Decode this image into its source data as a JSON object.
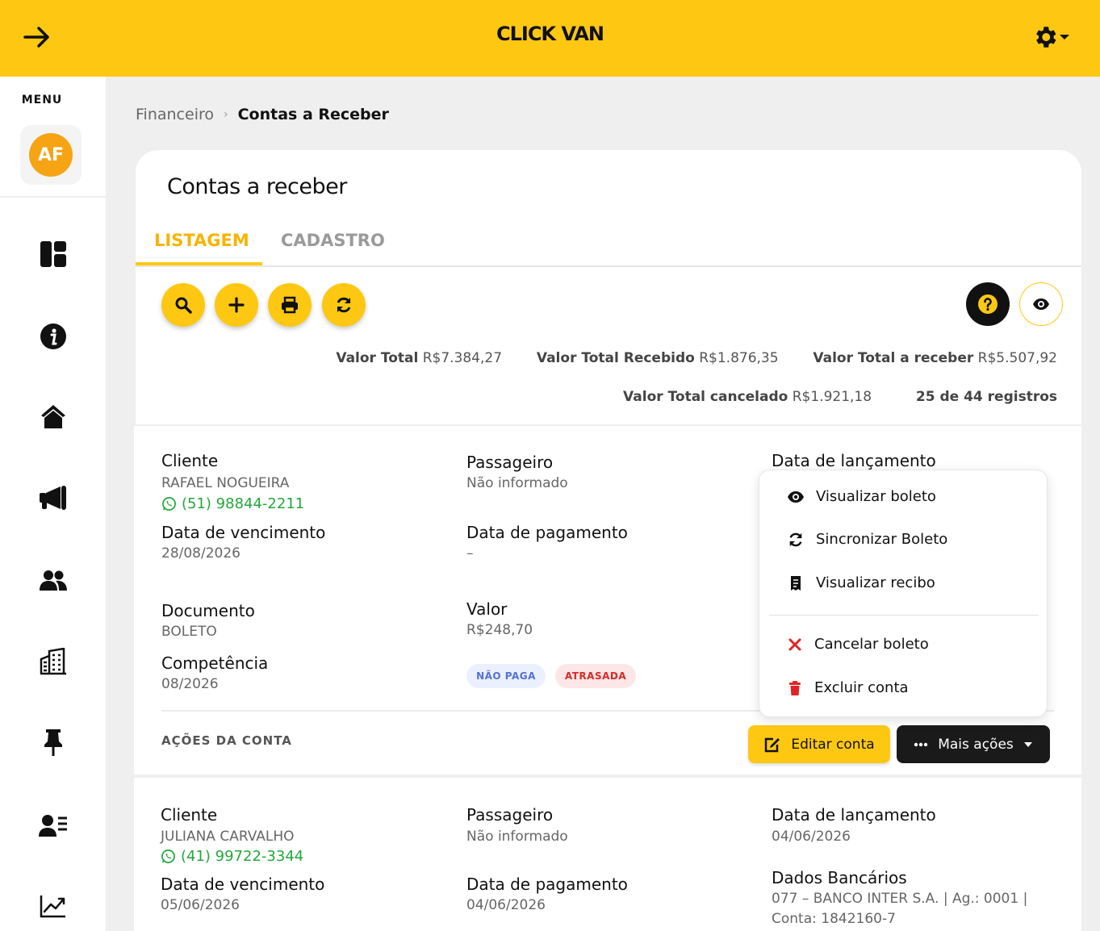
{
  "header": {
    "title": "CLICK VAN",
    "back_icon": "arrow-right-icon",
    "settings_icon": "gear-icon"
  },
  "sidebar": {
    "menu_label": "MENU",
    "avatar_initials": "AF",
    "icons": [
      "dashboard-icon",
      "info-icon",
      "home-icon",
      "megaphone-icon",
      "users-icon",
      "building-icon",
      "pin-icon",
      "contacts-list-icon",
      "chart-line-icon"
    ]
  },
  "breadcrumb": {
    "parent": "Financeiro",
    "separator": "›",
    "current": "Contas a Receber"
  },
  "page": {
    "title": "Contas a receber",
    "tabs": [
      {
        "label": "LISTAGEM",
        "active": true
      },
      {
        "label": "CADASTRO",
        "active": false
      }
    ]
  },
  "toolbar": {
    "buttons": [
      "search-icon",
      "plus-icon",
      "print-icon",
      "refresh-icon"
    ],
    "help_icon": "question-icon",
    "visibility_icon": "eye-icon"
  },
  "totals": {
    "valor_total_label": "Valor Total",
    "valor_total": "R$7.384,27",
    "recebido_label": "Valor Total Recebido",
    "recebido": "R$1.876,35",
    "a_receber_label": "Valor Total a receber",
    "a_receber": "R$5.507,92",
    "cancelado_label": "Valor Total cancelado",
    "cancelado": "R$1.921,18",
    "registros": "25 de 44 registros"
  },
  "labels": {
    "cliente": "Cliente",
    "passageiro": "Passageiro",
    "data_lancamento": "Data de lançamento",
    "data_vencimento": "Data de vencimento",
    "data_pagamento": "Data de pagamento",
    "documento": "Documento",
    "valor": "Valor",
    "competencia": "Competência",
    "dados_bancarios": "Dados Bancários",
    "acoes_da_conta": "AÇÕES DA CONTA",
    "editar_conta": "Editar conta",
    "mais_acoes": "Mais ações"
  },
  "accounts": [
    {
      "cliente": "RAFAEL NOGUEIRA",
      "telefone": "(51) 98844-2211",
      "passageiro": "Não informado",
      "data_vencimento": "28/08/2026",
      "data_pagamento": "–",
      "documento": "BOLETO",
      "valor": "R$248,70",
      "competencia": "08/2026",
      "badges": [
        "NÃO PAGA",
        "ATRASADA"
      ]
    },
    {
      "cliente": "JULIANA CARVALHO",
      "telefone": "(41) 99722-3344",
      "passageiro": "Não informado",
      "data_lancamento": "04/06/2026",
      "data_vencimento": "05/06/2026",
      "data_pagamento": "04/06/2026",
      "dados_bancarios_1": "077 – BANCO INTER S.A. | Ag.: 0001 |",
      "dados_bancarios_2": "Conta: 1842160-7"
    }
  ],
  "dropdown": {
    "items": [
      {
        "label": "Visualizar boleto",
        "icon": "eye-icon"
      },
      {
        "label": "Sincronizar Boleto",
        "icon": "sync-icon"
      },
      {
        "label": "Visualizar recibo",
        "icon": "receipt-icon"
      },
      {
        "label": "Cancelar boleto",
        "icon": "close-icon"
      },
      {
        "label": "Excluir conta",
        "icon": "trash-icon"
      }
    ]
  },
  "colors": {
    "brand_yellow": "#fec812",
    "tab_active": "#f6b400",
    "phone_green": "#22a83a",
    "danger_red": "#e02424"
  }
}
